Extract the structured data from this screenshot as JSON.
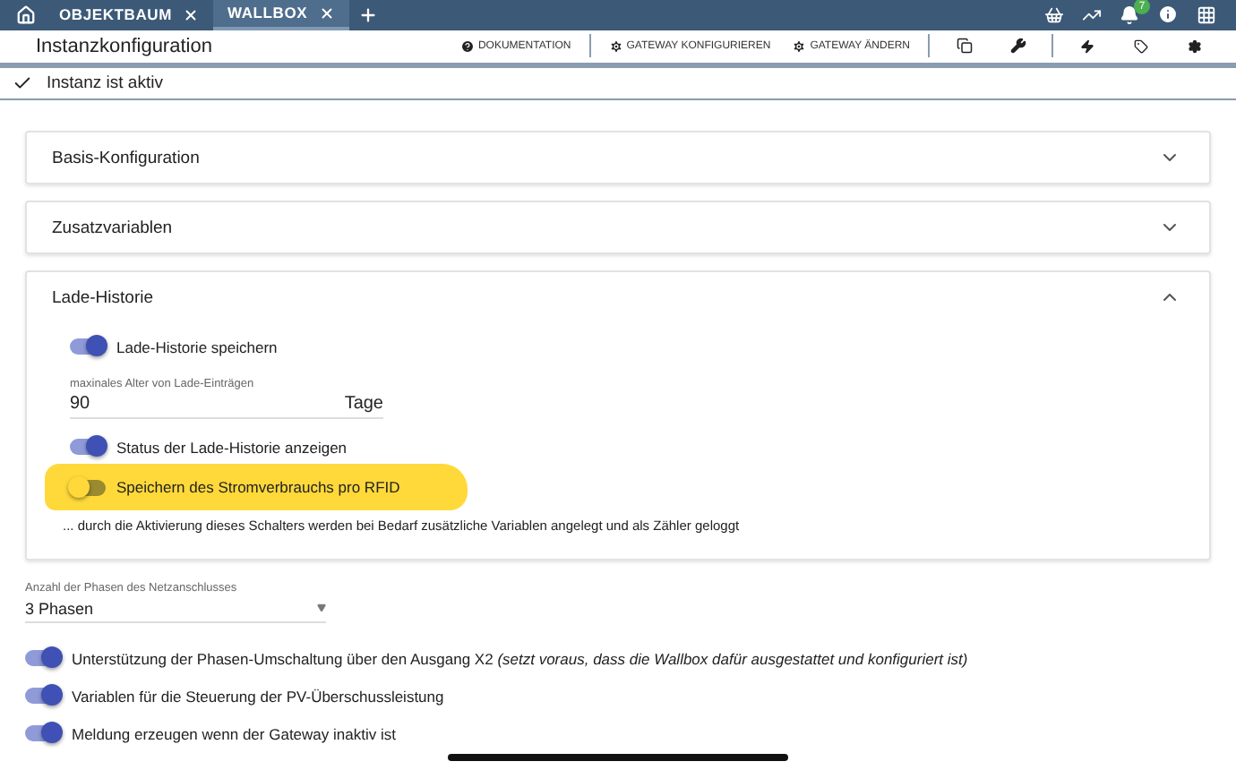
{
  "tabs": [
    {
      "label": "OBJEKTBAUM",
      "selected": false
    },
    {
      "label": "WALLBOX",
      "selected": true
    }
  ],
  "notifications": {
    "badge": "7"
  },
  "toolbar": {
    "title": "Instanzkonfiguration",
    "buttons": [
      {
        "label": "DOKUMENTATION",
        "kind": "help"
      },
      {
        "label": "GATEWAY KONFIGURIEREN",
        "kind": "gear"
      },
      {
        "label": "GATEWAY ÄNDERN",
        "kind": "gear"
      }
    ]
  },
  "status": {
    "text": "Instanz ist aktiv"
  },
  "panels": [
    {
      "title": "Basis-Konfiguration",
      "expanded": false
    },
    {
      "title": "Zusatzvariablen",
      "expanded": false
    },
    {
      "title": "Lade-Historie",
      "expanded": true,
      "items": [
        {
          "kind": "switch",
          "label": "Lade-Historie speichern",
          "on": true,
          "highlighted": false
        },
        {
          "kind": "number",
          "label": "maxinales Alter von Lade-Einträgen",
          "value": "90",
          "unit": "Tage"
        },
        {
          "kind": "switch",
          "label": "Status der Lade-Historie anzeigen",
          "on": true,
          "highlighted": false
        },
        {
          "kind": "switch",
          "label": "Speichern des Stromverbrauchs pro RFID",
          "on": false,
          "highlighted": true
        },
        {
          "kind": "note",
          "text": "... durch die Aktivierung dieses Schalters werden bei Bedarf zusätzliche Variablen angelegt und als Zähler geloggt"
        }
      ]
    }
  ],
  "phases": {
    "label": "Anzahl der Phasen des Netzanschlusses",
    "value": "3 Phasen"
  },
  "switches": [
    {
      "label": "Unterstützung der Phasen-Umschaltung über den Ausgang X2  *(setzt voraus, dass die Wallbox dafür ausgestattet und konfiguriert ist)*",
      "on": true
    },
    {
      "label": "Variablen für die Steuerung der PV-Überschussleistung",
      "on": true
    },
    {
      "label": "Meldung erzeugen wenn der Gateway inaktiv ist",
      "on": true
    }
  ]
}
